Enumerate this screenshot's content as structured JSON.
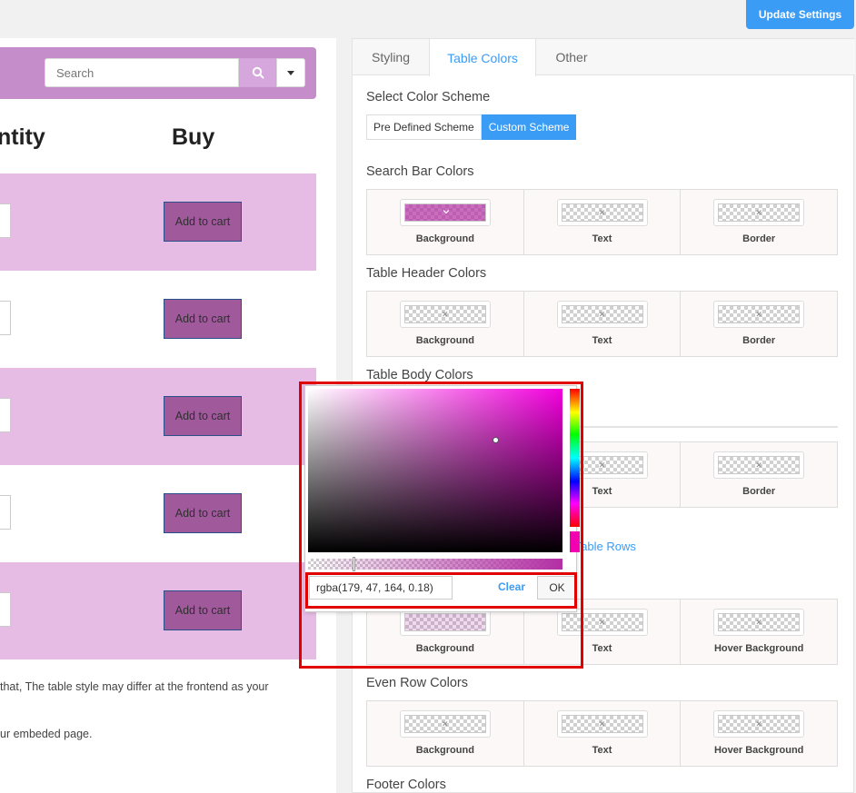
{
  "top_bar": {
    "update_button": "Update Settings"
  },
  "preview": {
    "search_placeholder": "Search",
    "headers": {
      "quantity": "ntity",
      "buy": "Buy"
    },
    "rows": [
      {
        "button": "Add to cart"
      },
      {
        "button": "Add to cart"
      },
      {
        "button": "Add to cart"
      },
      {
        "button": "Add to cart"
      },
      {
        "button": "Add to cart"
      }
    ],
    "note_line1": "that, The table style may differ at the frontend as your",
    "note_line2": "ur embeded page."
  },
  "settings": {
    "tabs": [
      "Styling",
      "Table Colors",
      "Other"
    ],
    "active_tab": "Table Colors",
    "scheme_title": "Select Color Scheme",
    "scheme_options": [
      "Pre Defined Scheme",
      "Custom Scheme"
    ],
    "search_bar_title": "Search Bar Colors",
    "search_bar_cells": [
      "Background",
      "Text",
      "Border"
    ],
    "header_title": "Table Header Colors",
    "header_cells": [
      "Background",
      "Text",
      "Border"
    ],
    "body_title": "Table Body Colors",
    "body_cells": [
      "Text",
      "Border"
    ],
    "rows_link": "r Table Rows",
    "odd_cells": [
      "Background",
      "Text",
      "Hover Background"
    ],
    "even_title": "Even Row Colors",
    "even_cells": [
      "Background",
      "Text",
      "Hover Background"
    ],
    "footer_title": "Footer Colors"
  },
  "color_picker": {
    "value": "rgba(179, 47, 164, 0.18)",
    "clear_label": "Clear",
    "ok_label": "OK"
  },
  "colors": {
    "accent": "#3b9cf5",
    "search_bar_bg": "#c58ecb",
    "odd_row_bg": "#e6bbe4",
    "cart_button_bg": "#a05a9c",
    "highlight": "#e00000"
  }
}
